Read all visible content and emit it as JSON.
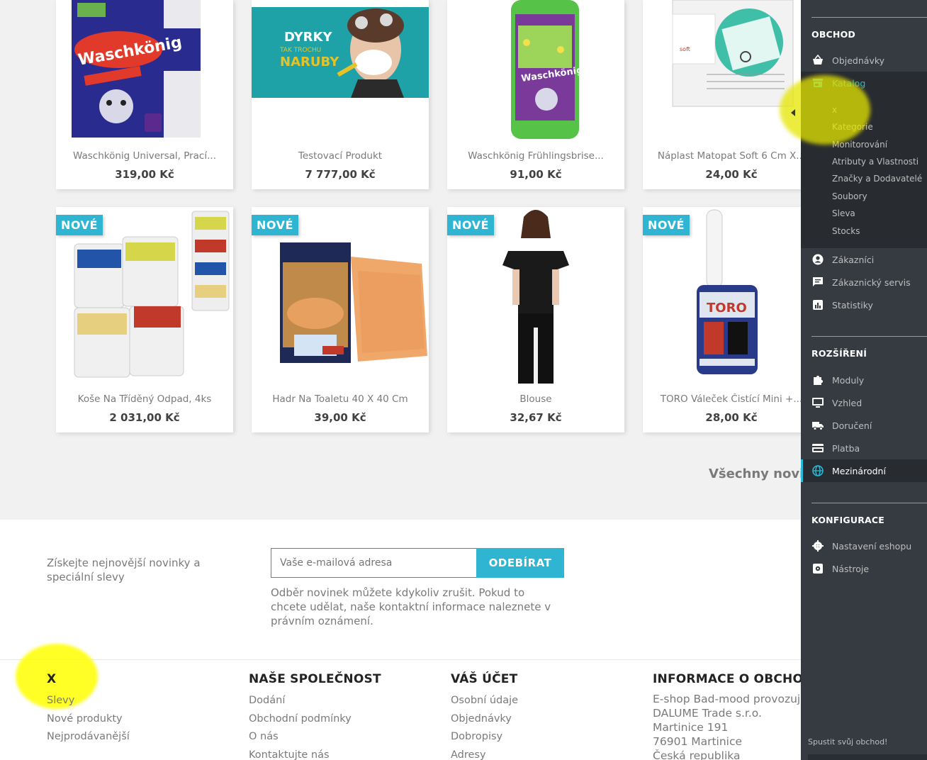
{
  "products": {
    "row1": [
      {
        "name": "Waschkönig Universal, Prací...",
        "price": "319,00 Kč"
      },
      {
        "name": "Testovací Produkt",
        "price": "7 777,00 Kč"
      },
      {
        "name": "Waschkönig Frühlingsbrise...",
        "price": "91,00 Kč"
      },
      {
        "name": "Náplast Matopat Soft 6 Cm X...",
        "price": "24,00 Kč"
      }
    ],
    "row2": [
      {
        "badge": "NOVÉ",
        "name": "Koše Na Tříděný Odpad, 4ks",
        "price": "2 031,00 Kč"
      },
      {
        "badge": "NOVÉ",
        "name": "Hadr Na Toaletu 40 X 40 Cm",
        "price": "39,00 Kč"
      },
      {
        "badge": "NOVÉ",
        "name": "Blouse",
        "price": "32,67 Kč"
      },
      {
        "badge": "NOVÉ",
        "name": "TORO Váleček Čistící Mini +...",
        "price": "28,00 Kč"
      }
    ],
    "banner_text_1": "DYRKY",
    "banner_text_2": "TAK TROCHU",
    "banner_text_3": "NARUBY",
    "all_new_link": "Všechny novin"
  },
  "newsletter": {
    "text": "Získejte nejnovější novinky a speciální slevy",
    "placeholder": "Vaše e-mailová adresa",
    "button": "ODEBÍRAT",
    "note": "Odběr novinek můžete kdykoliv zrušit. Pokud to chcete udělat, naše kontaktní informace naleznete v právním oznámení."
  },
  "footer": {
    "col1": {
      "title": "X",
      "links": [
        "Slevy",
        "Nové produkty",
        "Nejprodávanější"
      ]
    },
    "col2": {
      "title": "NAŠE SPOLEČNOST",
      "links": [
        "Dodání",
        "Obchodní podmínky",
        "O nás",
        "Kontaktujte nás"
      ]
    },
    "col3": {
      "title": "VÁŠ ÚČET",
      "links": [
        "Osobní údaje",
        "Objednávky",
        "Dobropisy",
        "Adresy"
      ]
    },
    "col4": {
      "title": "INFORMACE O OBCHODU",
      "lines": [
        "E-shop Bad-mood provozuje",
        "DALUME Trade s.r.o.",
        "Martinice 191",
        "76901 Martinice",
        "Česká republika"
      ]
    }
  },
  "sidebar": {
    "section_shop": "OBCHOD",
    "orders": "Objednávky",
    "catalog": "Katalog",
    "catalog_sub": [
      "x",
      "Kategorie",
      "Monitorování",
      "Atributy a Vlastnosti",
      "Značky a Dodavatelé",
      "Soubory",
      "Sleva",
      "Stocks"
    ],
    "customers": "Zákazníci",
    "service": "Zákaznický servis",
    "stats": "Statistiky",
    "section_ext": "ROZŠÍŘENÍ",
    "modules": "Moduly",
    "design": "Vzhled",
    "shipping": "Doručení",
    "payment": "Platba",
    "international": "Mezinárodní",
    "section_config": "KONFIGURACE",
    "shop_settings": "Nastavení eshopu",
    "tools": "Nástroje",
    "footer": "Spustit svůj obchod!"
  },
  "colors": {
    "accent": "#2fb5d2",
    "sidebar_bg": "#363a41",
    "highlight": "#ffff00"
  }
}
